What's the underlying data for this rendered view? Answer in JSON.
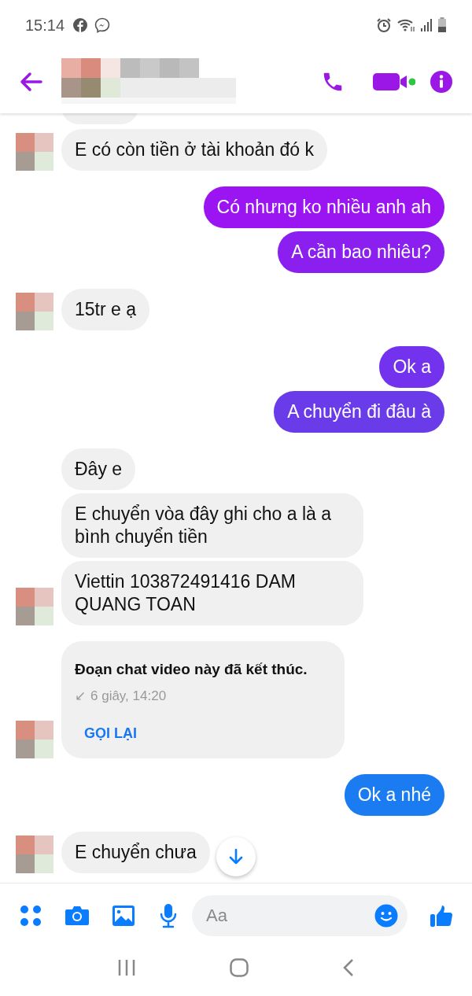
{
  "status_bar": {
    "time": "15:14"
  },
  "composer": {
    "placeholder": "Aa"
  },
  "groups": [
    {
      "kind": "incoming",
      "avatar": true,
      "messages": [
        {
          "kind": "text",
          "text": "E có còn tiền ở tài khoản đó k"
        }
      ]
    },
    {
      "kind": "outgoing",
      "messages": [
        {
          "kind": "text",
          "text": "Có nhưng ko nhiều anh ah",
          "color": "#9a15f2"
        },
        {
          "kind": "text",
          "text": "A cần bao nhiêu?",
          "color": "#8a1ff0"
        }
      ]
    },
    {
      "kind": "incoming",
      "avatar": true,
      "messages": [
        {
          "kind": "text",
          "text": "15tr e ạ"
        }
      ]
    },
    {
      "kind": "outgoing",
      "messages": [
        {
          "kind": "text",
          "text": "Ok a",
          "color": "#7232ee"
        },
        {
          "kind": "text",
          "text": "A chuyển đi đâu à",
          "color": "#6a3be9"
        }
      ]
    },
    {
      "kind": "incoming",
      "avatar": true,
      "messages": [
        {
          "kind": "text",
          "text": "Đây e"
        },
        {
          "kind": "text",
          "text": "E chuyển vòa đây ghi cho a là a bình chuyển tiền"
        },
        {
          "kind": "text",
          "text": "Viettin 103872491416 DAM QUANG TOAN"
        }
      ]
    },
    {
      "kind": "incoming",
      "avatar": true,
      "messages": [
        {
          "kind": "call",
          "title": "Đoạn chat video này đã kết thúc.",
          "arrow": "↙",
          "detail": "6 giây, 14:20",
          "action": "GỌI LẠI"
        }
      ]
    },
    {
      "kind": "outgoing",
      "messages": [
        {
          "kind": "text",
          "text": "Ok a nhé",
          "color": "#1b7cf2"
        }
      ]
    },
    {
      "kind": "incoming",
      "avatar": true,
      "messages": [
        {
          "kind": "text",
          "text": "E chuyển chưa"
        }
      ]
    }
  ]
}
